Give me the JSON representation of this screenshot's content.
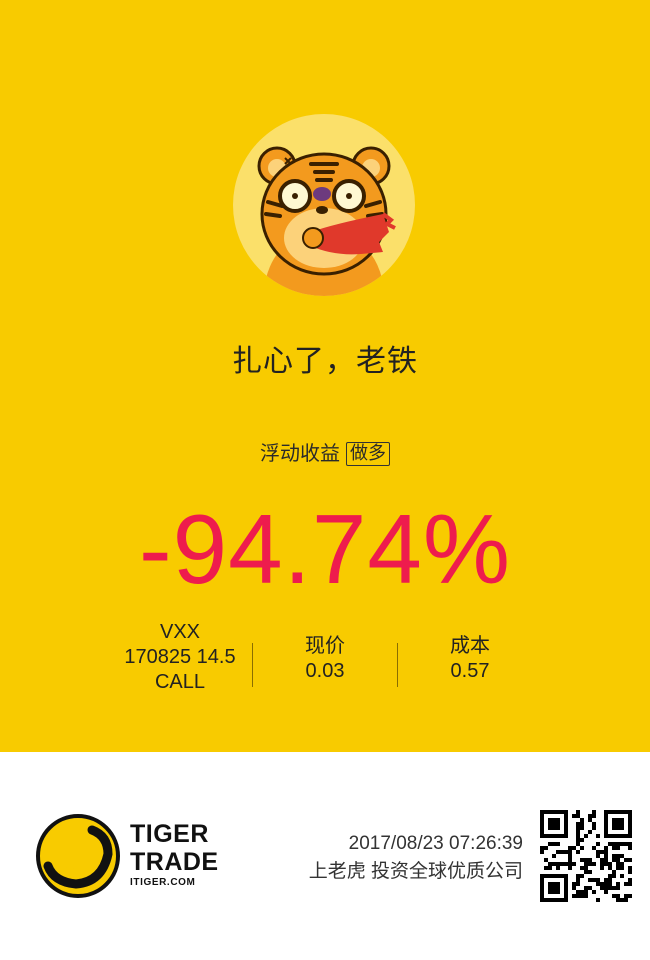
{
  "headline": "扎心了，老铁",
  "pnl": {
    "label": "浮动收益",
    "tag": "做多",
    "percent": "-94.74%"
  },
  "position": {
    "symbol": "VXX",
    "contract": "170825 14.5",
    "type": "CALL"
  },
  "current_price": {
    "label": "现价",
    "value": "0.03"
  },
  "cost": {
    "label": "成本",
    "value": "0.57"
  },
  "footer": {
    "brand_line1": "TIGER",
    "brand_line2": "TRADE",
    "brand_site": "ITIGER.COM",
    "timestamp": "2017/08/23 07:26:39",
    "slogan": "上老虎 投资全球优质公司"
  },
  "icons": {
    "avatar": "tiger-mascot-icon",
    "logo": "tiger-trade-logo-icon",
    "qr": "qr-code-icon"
  },
  "colors": {
    "background": "#f8cb00",
    "loss": "#ee1c4d"
  }
}
